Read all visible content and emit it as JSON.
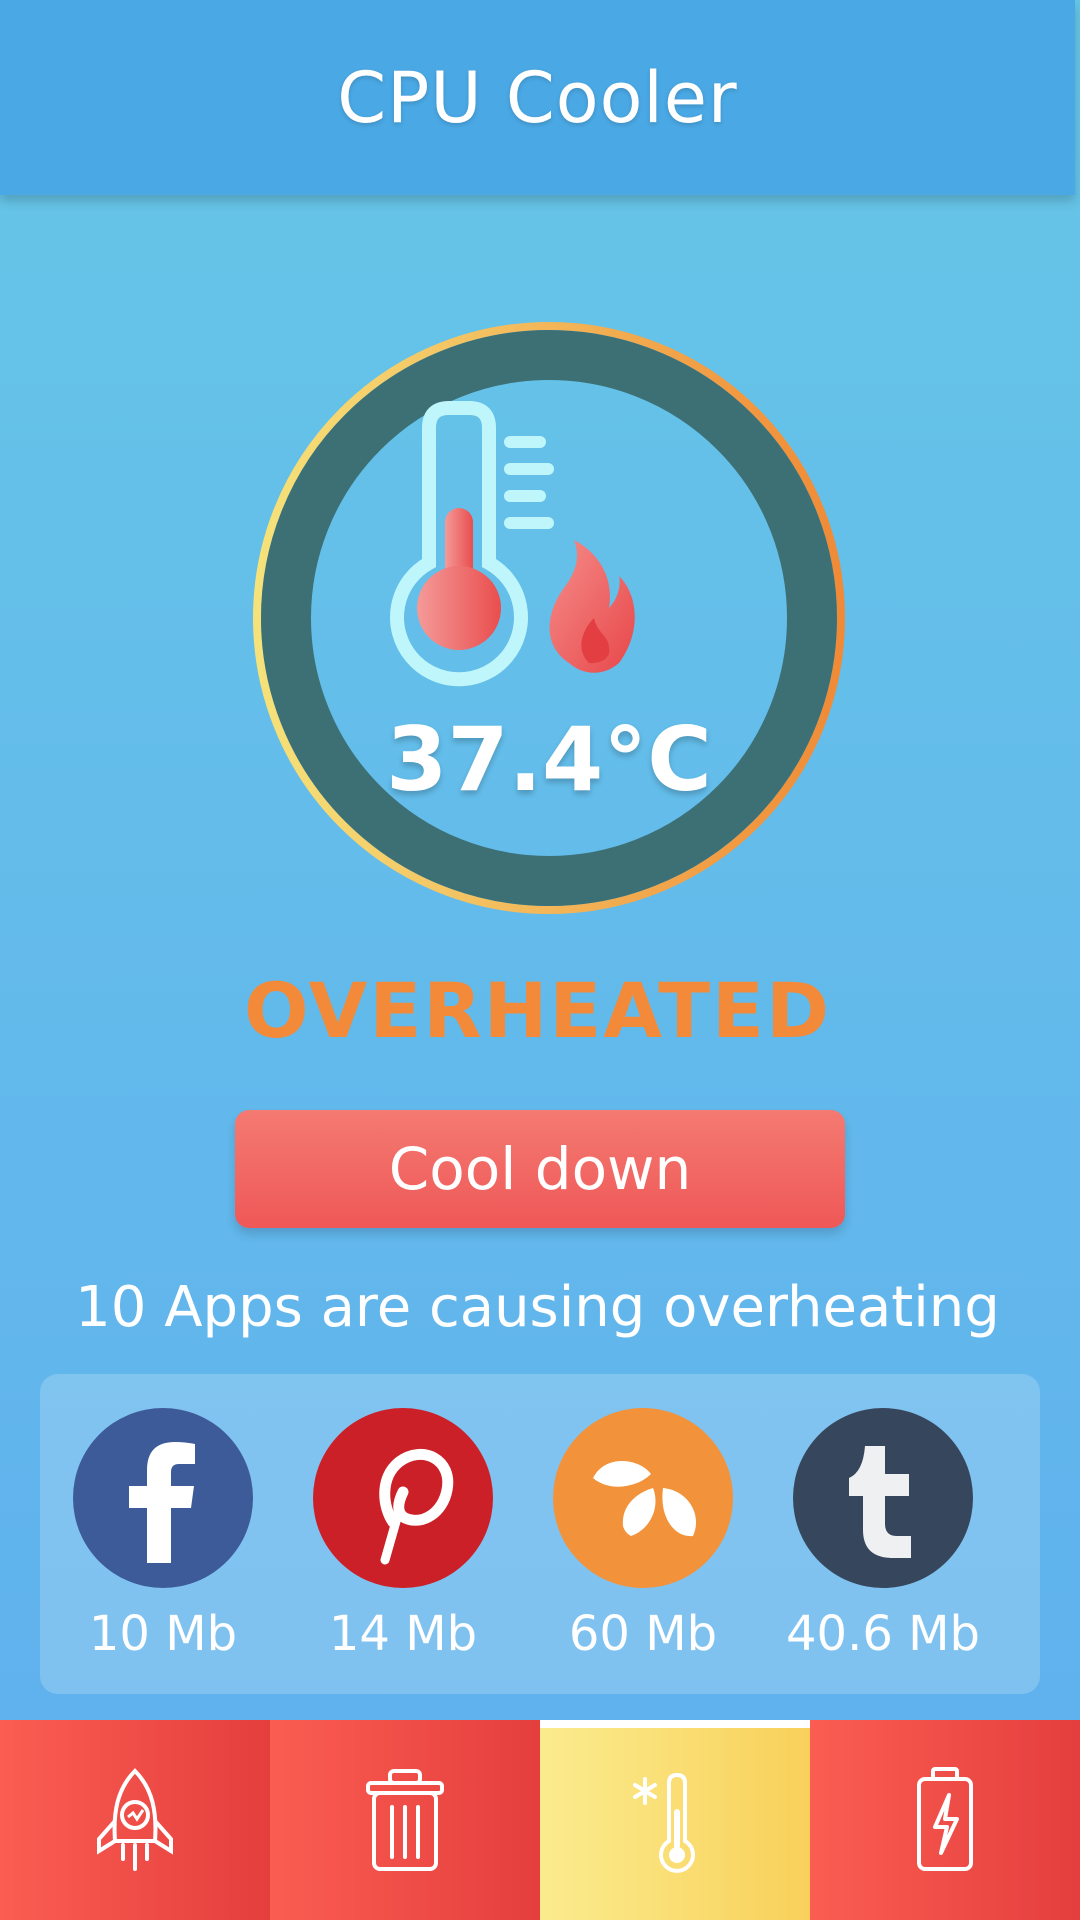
{
  "header": {
    "title": "CPU Cooler"
  },
  "gauge": {
    "temperature": "37.4°C",
    "icons": [
      "thermometer-icon",
      "flame-icon"
    ]
  },
  "status": {
    "label": "OVERHEATED",
    "color": "#f28a3a"
  },
  "action": {
    "cool_down_label": "Cool down"
  },
  "apps": {
    "caption": "10 Apps are causing overheating",
    "items": [
      {
        "name": "facebook-icon",
        "size": "10 Mb",
        "color": "#3d5a99"
      },
      {
        "name": "pinterest-icon",
        "size": "14 Mb",
        "color": "#cb2027"
      },
      {
        "name": "swarm-icon",
        "size": "60 Mb",
        "color": "#f2923a"
      },
      {
        "name": "tumblr-icon",
        "size": "40.6 Mb",
        "color": "#36465d"
      }
    ]
  },
  "bottom_nav": {
    "items": [
      {
        "icon": "rocket-boost-icon",
        "active": false
      },
      {
        "icon": "trash-icon",
        "active": false
      },
      {
        "icon": "cooler-thermometer-icon",
        "active": true
      },
      {
        "icon": "battery-icon",
        "active": false
      }
    ]
  },
  "colors": {
    "accent_red": "#ef5857",
    "accent_yellow": "#f9d05a",
    "header_blue": "#4aa8e4"
  }
}
